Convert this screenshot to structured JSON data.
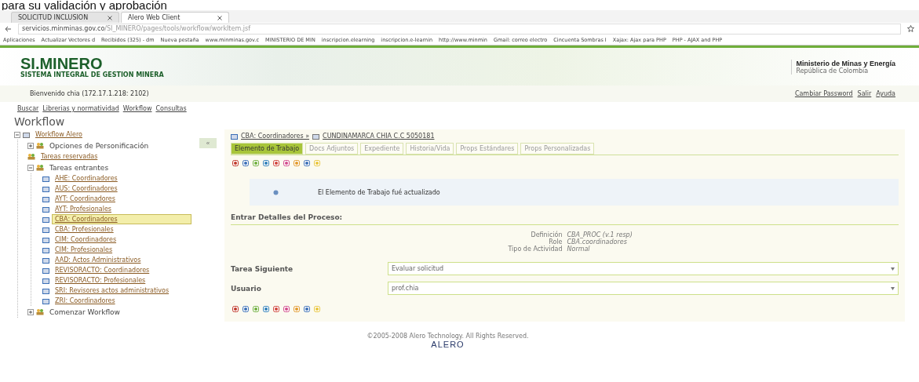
{
  "caption": "para su validación y aprobación",
  "browser": {
    "tabs": [
      {
        "label": "SOLICITUD INCLUSION",
        "selected": false
      },
      {
        "label": "Alero Web Client",
        "selected": true
      }
    ],
    "url_host": "servicios.minminas.gov.co",
    "url_path": "/SI_MINERO/pages/tools/workflow/workItem.jsf",
    "bookmarks": [
      "Aplicaciones",
      "Actualizar Vectores d",
      "Recibidos (325) - dm",
      "Nueva pestaña",
      "www.minminas.gov.c",
      "MINISTERIO DE MIN",
      "inscripcion.elearning",
      "inscripcion.e-learnin",
      "http://www.minmin",
      "Gmail: correo electro",
      "Cincuenta Sombras I",
      "Xajax: Ajax para PHP",
      "PHP - AJAX and PHP"
    ]
  },
  "header": {
    "logo": "SI.MINERO",
    "logo_subtitle": "SISTEMA INTEGRAL DE GESTION MINERA",
    "ministry": "Ministerio de Minas y Energía",
    "country": "República de Colombia",
    "welcome": "Bienvenido chia (172.17.1.218: 2102)",
    "user_links": [
      "Cambiar Password",
      "Salir",
      "Ayuda"
    ],
    "nav": [
      "Buscar",
      "Librerias y normatividad",
      "Workflow",
      "Consultas"
    ]
  },
  "page_title": "Workflow",
  "tree": [
    {
      "label": "Workflow Alero",
      "kind": "root",
      "expanded": true,
      "children": [
        {
          "label": "Opciones de Personificación",
          "kind": "group",
          "expanded": false
        },
        {
          "label": "Tareas reservadas",
          "kind": "leaf",
          "selected": false
        },
        {
          "label": "Tareas entrantes",
          "kind": "group",
          "expanded": true,
          "children": [
            {
              "label": "AHE: Coordinadores",
              "kind": "task",
              "selected": false
            },
            {
              "label": "AUS: Coordinadores",
              "kind": "task",
              "selected": false
            },
            {
              "label": "AYT: Coordinadores",
              "kind": "task",
              "selected": false
            },
            {
              "label": "AYT: Profesionales",
              "kind": "task",
              "selected": false
            },
            {
              "label": "CBA: Coordinadores",
              "kind": "task",
              "selected": true
            },
            {
              "label": "CBA: Profesionales",
              "kind": "task",
              "selected": false
            },
            {
              "label": "CIM: Coordinadores",
              "kind": "task",
              "selected": false
            },
            {
              "label": "CIM: Profesionales",
              "kind": "task",
              "selected": false
            },
            {
              "label": "AAD: Actos Administrativos",
              "kind": "task",
              "selected": false
            },
            {
              "label": "REVISORACTO: Coordinadores",
              "kind": "task",
              "selected": false
            },
            {
              "label": "REVISORACTO: Profesionales",
              "kind": "task",
              "selected": false
            },
            {
              "label": "SRI: Revisores actos administrativos",
              "kind": "task",
              "selected": false
            },
            {
              "label": "ZRI: Coordinadores",
              "kind": "task",
              "selected": false
            }
          ]
        },
        {
          "label": "Comenzar Workflow",
          "kind": "group",
          "expanded": false
        }
      ]
    }
  ],
  "collapse_button": "«",
  "breadcrumb": [
    "CBA: Coordinadores »",
    "CUNDINAMARCA CHIA C.C 5050181"
  ],
  "tabs": [
    {
      "label": "Elemento de Trabajo",
      "selected": true
    },
    {
      "label": "Docs Adjuntos",
      "selected": false
    },
    {
      "label": "Expediente",
      "selected": false
    },
    {
      "label": "Historia/Vida",
      "selected": false
    },
    {
      "label": "Props Estándares",
      "selected": false
    },
    {
      "label": "Props Personalizadas",
      "selected": false
    }
  ],
  "message": "El Elemento de Trabajo fué actualizado",
  "section_title": "Entrar Detalles del Proceso:",
  "details": [
    {
      "label": "Definición",
      "value": "CBA_PROC (v.1 resp)"
    },
    {
      "label": "Role",
      "value": "CBA.coordinadores"
    },
    {
      "label": "Tipo de Actividad",
      "value": "Normal"
    }
  ],
  "fields": [
    {
      "label": "Tarea Siguiente",
      "value": "Evaluar solicitud"
    },
    {
      "label": "Usuario",
      "value": "prof.chia"
    }
  ],
  "footer": {
    "copyright": "©2005-2008 Alero Technology. All Rights Reserved.",
    "logo": "ALERO"
  }
}
